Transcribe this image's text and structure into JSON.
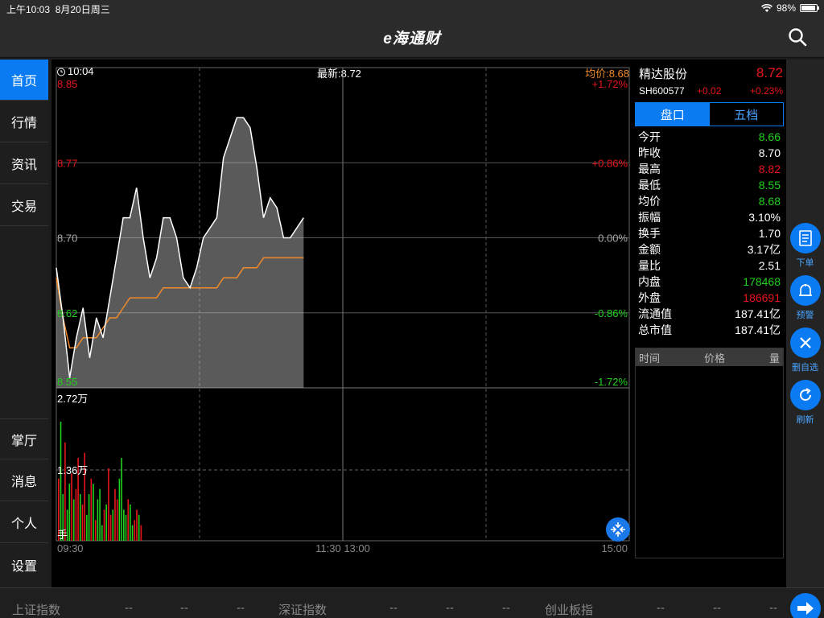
{
  "status": {
    "time": "上午10:03",
    "date": "8月20日周三",
    "battery": "98%"
  },
  "header": {
    "title": "e海通财"
  },
  "sidebar": {
    "top": [
      {
        "label": "首页",
        "active": true
      },
      {
        "label": "行情"
      },
      {
        "label": "资讯"
      },
      {
        "label": "交易"
      }
    ],
    "bottom": [
      {
        "label": "掌厅"
      },
      {
        "label": "消息"
      },
      {
        "label": "个人"
      },
      {
        "label": "设置"
      }
    ]
  },
  "chart_header": {
    "time": "10:04",
    "latest": "最新:8.72",
    "avg": "均价:8.68"
  },
  "chart_data": {
    "type": "line",
    "x_ticks": [
      "09:30",
      "11:30 13:00",
      "15:00"
    ],
    "price_ticks": [
      {
        "price": "8.85",
        "pct": "+1.72%",
        "color": "#e8141b"
      },
      {
        "price": "8.77",
        "pct": "+0.86%",
        "color": "#e8141b"
      },
      {
        "price": "8.70",
        "pct": "0.00%",
        "color": "#aaaaaa"
      },
      {
        "price": "8.62",
        "pct": "-0.86%",
        "color": "#22d11e"
      },
      {
        "price": "8.55",
        "pct": "-1.72%",
        "color": "#22d11e"
      }
    ],
    "ylim": [
      8.55,
      8.85
    ],
    "volume_ticks": [
      "2.72万",
      "1.36万",
      "手"
    ],
    "series": [
      {
        "values": [
          8.67,
          8.62,
          8.56,
          8.6,
          8.63,
          8.58,
          8.62,
          8.6,
          8.64,
          8.68,
          8.72,
          8.72,
          8.75,
          8.7,
          8.66,
          8.68,
          8.72,
          8.72,
          8.7,
          8.66,
          8.65,
          8.67,
          8.7,
          8.71,
          8.72,
          8.78,
          8.8,
          8.82,
          8.82,
          8.81,
          8.77,
          8.72,
          8.74,
          8.73,
          8.7,
          8.7,
          8.71,
          8.72
        ],
        "color": "#ffffff"
      },
      {
        "values": [
          8.66,
          8.62,
          8.59,
          8.59,
          8.6,
          8.6,
          8.6,
          8.61,
          8.62,
          8.62,
          8.63,
          8.64,
          8.64,
          8.64,
          8.64,
          8.64,
          8.65,
          8.65,
          8.65,
          8.65,
          8.65,
          8.65,
          8.65,
          8.65,
          8.65,
          8.66,
          8.66,
          8.66,
          8.67,
          8.67,
          8.67,
          8.68,
          8.68,
          8.68,
          8.68,
          8.68,
          8.68,
          8.68
        ],
        "color": "#f08a2a"
      }
    ],
    "volume": [
      1.2,
      2.3,
      0.9,
      1.9,
      0.6,
      1.1,
      1.3,
      0.8,
      1.0,
      1.6,
      0.9,
      0.7,
      1.7,
      0.5,
      0.9,
      1.2,
      1.1,
      0.4,
      0.8,
      1.0,
      0.3,
      0.6,
      0.7,
      1.4,
      0.5,
      0.6,
      1.0,
      0.8,
      1.2,
      1.6,
      0.6,
      0.5,
      0.8,
      0.7,
      0.3,
      0.4,
      0.6,
      0.5,
      0.3
    ],
    "volume_max": 2.72
  },
  "quote": {
    "name": "精达股份",
    "price": "8.72",
    "code": "SH600577",
    "change": "+0.02",
    "pct": "+0.23%",
    "tabs": [
      {
        "label": "盘口",
        "active": true
      },
      {
        "label": "五档"
      }
    ],
    "stats": [
      {
        "k": "今开",
        "v": "8.66",
        "color": "#22d11e"
      },
      {
        "k": "昨收",
        "v": "8.70",
        "color": "#ffffff"
      },
      {
        "k": "最高",
        "v": "8.82",
        "color": "#e8141b"
      },
      {
        "k": "最低",
        "v": "8.55",
        "color": "#22d11e"
      },
      {
        "k": "均价",
        "v": "8.68",
        "color": "#22d11e"
      },
      {
        "k": "振幅",
        "v": "3.10%",
        "color": "#ffffff"
      },
      {
        "k": "换手",
        "v": "1.70",
        "color": "#ffffff"
      },
      {
        "k": "金额",
        "v": "3.17亿",
        "color": "#ffffff"
      },
      {
        "k": "量比",
        "v": "2.51",
        "color": "#ffffff"
      },
      {
        "k": "内盘",
        "v": "178468",
        "color": "#22d11e"
      },
      {
        "k": "外盘",
        "v": "186691",
        "color": "#e8141b"
      },
      {
        "k": "流通值",
        "v": "187.41亿",
        "color": "#ffffff"
      },
      {
        "k": "总市值",
        "v": "187.41亿",
        "color": "#ffffff"
      }
    ],
    "trade_headers": [
      "时间",
      "价格",
      "量"
    ]
  },
  "actions": [
    {
      "label": "下单",
      "icon": "order-icon"
    },
    {
      "label": "预警",
      "icon": "alert-bell-icon"
    },
    {
      "label": "删自选",
      "icon": "close-icon"
    },
    {
      "label": "刷新",
      "icon": "refresh-icon"
    }
  ],
  "ticker": [
    {
      "name": "上证指数",
      "v1": "--",
      "v2": "--",
      "v3": "--"
    },
    {
      "name": "深证指数",
      "v1": "--",
      "v2": "--",
      "v3": "--"
    },
    {
      "name": "创业板指",
      "v1": "--",
      "v2": "--",
      "v3": "--"
    }
  ],
  "colors": {
    "accent": "#0a7bf3",
    "up": "#e8141b",
    "down": "#22d11e",
    "avg": "#f08a2a"
  }
}
